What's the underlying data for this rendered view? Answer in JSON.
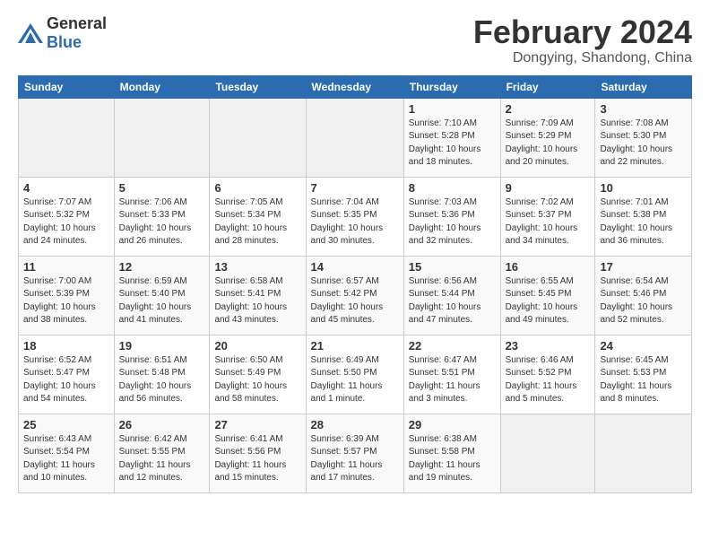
{
  "logo": {
    "text_general": "General",
    "text_blue": "Blue"
  },
  "header": {
    "month": "February 2024",
    "location": "Dongying, Shandong, China"
  },
  "days_of_week": [
    "Sunday",
    "Monday",
    "Tuesday",
    "Wednesday",
    "Thursday",
    "Friday",
    "Saturday"
  ],
  "weeks": [
    [
      {
        "day": "",
        "info": ""
      },
      {
        "day": "",
        "info": ""
      },
      {
        "day": "",
        "info": ""
      },
      {
        "day": "",
        "info": ""
      },
      {
        "day": "1",
        "info": "Sunrise: 7:10 AM\nSunset: 5:28 PM\nDaylight: 10 hours\nand 18 minutes."
      },
      {
        "day": "2",
        "info": "Sunrise: 7:09 AM\nSunset: 5:29 PM\nDaylight: 10 hours\nand 20 minutes."
      },
      {
        "day": "3",
        "info": "Sunrise: 7:08 AM\nSunset: 5:30 PM\nDaylight: 10 hours\nand 22 minutes."
      }
    ],
    [
      {
        "day": "4",
        "info": "Sunrise: 7:07 AM\nSunset: 5:32 PM\nDaylight: 10 hours\nand 24 minutes."
      },
      {
        "day": "5",
        "info": "Sunrise: 7:06 AM\nSunset: 5:33 PM\nDaylight: 10 hours\nand 26 minutes."
      },
      {
        "day": "6",
        "info": "Sunrise: 7:05 AM\nSunset: 5:34 PM\nDaylight: 10 hours\nand 28 minutes."
      },
      {
        "day": "7",
        "info": "Sunrise: 7:04 AM\nSunset: 5:35 PM\nDaylight: 10 hours\nand 30 minutes."
      },
      {
        "day": "8",
        "info": "Sunrise: 7:03 AM\nSunset: 5:36 PM\nDaylight: 10 hours\nand 32 minutes."
      },
      {
        "day": "9",
        "info": "Sunrise: 7:02 AM\nSunset: 5:37 PM\nDaylight: 10 hours\nand 34 minutes."
      },
      {
        "day": "10",
        "info": "Sunrise: 7:01 AM\nSunset: 5:38 PM\nDaylight: 10 hours\nand 36 minutes."
      }
    ],
    [
      {
        "day": "11",
        "info": "Sunrise: 7:00 AM\nSunset: 5:39 PM\nDaylight: 10 hours\nand 38 minutes."
      },
      {
        "day": "12",
        "info": "Sunrise: 6:59 AM\nSunset: 5:40 PM\nDaylight: 10 hours\nand 41 minutes."
      },
      {
        "day": "13",
        "info": "Sunrise: 6:58 AM\nSunset: 5:41 PM\nDaylight: 10 hours\nand 43 minutes."
      },
      {
        "day": "14",
        "info": "Sunrise: 6:57 AM\nSunset: 5:42 PM\nDaylight: 10 hours\nand 45 minutes."
      },
      {
        "day": "15",
        "info": "Sunrise: 6:56 AM\nSunset: 5:44 PM\nDaylight: 10 hours\nand 47 minutes."
      },
      {
        "day": "16",
        "info": "Sunrise: 6:55 AM\nSunset: 5:45 PM\nDaylight: 10 hours\nand 49 minutes."
      },
      {
        "day": "17",
        "info": "Sunrise: 6:54 AM\nSunset: 5:46 PM\nDaylight: 10 hours\nand 52 minutes."
      }
    ],
    [
      {
        "day": "18",
        "info": "Sunrise: 6:52 AM\nSunset: 5:47 PM\nDaylight: 10 hours\nand 54 minutes."
      },
      {
        "day": "19",
        "info": "Sunrise: 6:51 AM\nSunset: 5:48 PM\nDaylight: 10 hours\nand 56 minutes."
      },
      {
        "day": "20",
        "info": "Sunrise: 6:50 AM\nSunset: 5:49 PM\nDaylight: 10 hours\nand 58 minutes."
      },
      {
        "day": "21",
        "info": "Sunrise: 6:49 AM\nSunset: 5:50 PM\nDaylight: 11 hours\nand 1 minute."
      },
      {
        "day": "22",
        "info": "Sunrise: 6:47 AM\nSunset: 5:51 PM\nDaylight: 11 hours\nand 3 minutes."
      },
      {
        "day": "23",
        "info": "Sunrise: 6:46 AM\nSunset: 5:52 PM\nDaylight: 11 hours\nand 5 minutes."
      },
      {
        "day": "24",
        "info": "Sunrise: 6:45 AM\nSunset: 5:53 PM\nDaylight: 11 hours\nand 8 minutes."
      }
    ],
    [
      {
        "day": "25",
        "info": "Sunrise: 6:43 AM\nSunset: 5:54 PM\nDaylight: 11 hours\nand 10 minutes."
      },
      {
        "day": "26",
        "info": "Sunrise: 6:42 AM\nSunset: 5:55 PM\nDaylight: 11 hours\nand 12 minutes."
      },
      {
        "day": "27",
        "info": "Sunrise: 6:41 AM\nSunset: 5:56 PM\nDaylight: 11 hours\nand 15 minutes."
      },
      {
        "day": "28",
        "info": "Sunrise: 6:39 AM\nSunset: 5:57 PM\nDaylight: 11 hours\nand 17 minutes."
      },
      {
        "day": "29",
        "info": "Sunrise: 6:38 AM\nSunset: 5:58 PM\nDaylight: 11 hours\nand 19 minutes."
      },
      {
        "day": "",
        "info": ""
      },
      {
        "day": "",
        "info": ""
      }
    ]
  ]
}
